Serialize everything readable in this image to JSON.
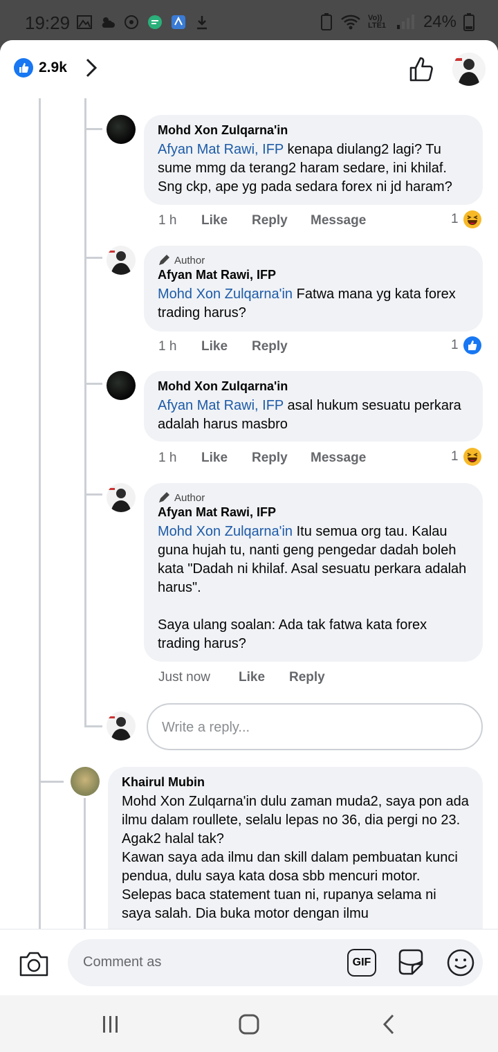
{
  "status": {
    "time": "19:29",
    "network": "Vo)) LTE1",
    "battery": "24%"
  },
  "header": {
    "like_count": "2.9k"
  },
  "comments": [
    {
      "name": "Mohd Xon Zulqarna'in",
      "mention": "Afyan Mat Rawi, IFP",
      "text": " kenapa diulang2 lagi? Tu sume mmg da terang2 haram sedare, ini khilaf. Sng ckp, ape yg pada sedara forex ni jd haram?",
      "time": "1 h",
      "like": "Like",
      "reply": "Reply",
      "message": "Message",
      "reaction_count": "1"
    },
    {
      "badge": "Author",
      "name": "Afyan Mat Rawi, IFP",
      "mention": "Mohd Xon Zulqarna'in",
      "text": " Fatwa mana yg kata forex trading harus?",
      "time": "1 h",
      "like": "Like",
      "reply": "Reply",
      "reaction_count": "1"
    },
    {
      "name": "Mohd Xon Zulqarna'in",
      "mention": "Afyan Mat Rawi, IFP",
      "text": " asal hukum sesuatu perkara adalah harus masbro",
      "time": "1 h",
      "like": "Like",
      "reply": "Reply",
      "message": "Message",
      "reaction_count": "1"
    },
    {
      "badge": "Author",
      "name": "Afyan Mat Rawi, IFP",
      "mention": "Mohd Xon Zulqarna'in",
      "text": " Itu semua org tau. Kalau guna hujah tu, nanti geng pengedar dadah boleh kata \"Dadah ni khilaf. Asal sesuatu perkara adalah harus\".\n\nSaya ulang soalan: Ada tak fatwa kata forex trading harus?",
      "time": "Just now",
      "like": "Like",
      "reply": "Reply"
    }
  ],
  "reply_placeholder": "Write a reply...",
  "khairul": {
    "name": "Khairul Mubin",
    "text": "Mohd Xon Zulqarna'in dulu zaman muda2, saya pon ada ilmu dalam roullete, selalu lepas no 36, dia pergi no 23. Agak2 halal tak?\nKawan saya ada ilmu dan skill dalam pembuatan kunci pendua, dulu saya kata dosa sbb mencuri motor. Selepas baca statement tuan ni, rupanya selama ni saya salah. Dia buka motor dengan ilmu"
  },
  "composer": {
    "placeholder": "Comment as",
    "gif_label": "GIF"
  },
  "colors": {
    "facebook_blue": "#1877f2",
    "mention": "#1d5ba8",
    "bubble": "#f0f2f5",
    "meta_text": "#65676b"
  }
}
